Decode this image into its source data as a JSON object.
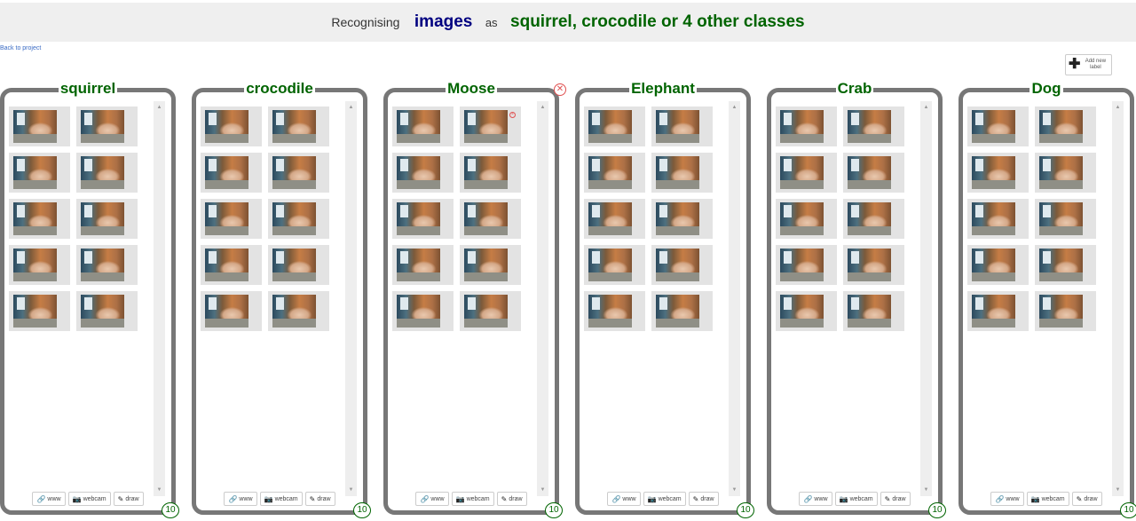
{
  "header": {
    "prefix": "Recognising",
    "type": "images",
    "as": "as",
    "classes": "squirrel, crocodile or 4 other classes"
  },
  "back_link": "Back to project",
  "add_label": {
    "icon": "plus-icon",
    "text": "Add new label"
  },
  "buttons": {
    "www": "www",
    "webcam": "webcam",
    "draw": "draw"
  },
  "labels": [
    {
      "name": "squirrel",
      "count": "10"
    },
    {
      "name": "crocodile",
      "count": "10"
    },
    {
      "name": "Moose",
      "count": "10"
    },
    {
      "name": "Elephant",
      "count": "10"
    },
    {
      "name": "Crab",
      "count": "10"
    },
    {
      "name": "Dog",
      "count": "10"
    }
  ],
  "colors": {
    "label_text": "#006400",
    "type_text": "#000080",
    "box_border": "#777777",
    "delete_icon": "#e05050"
  }
}
